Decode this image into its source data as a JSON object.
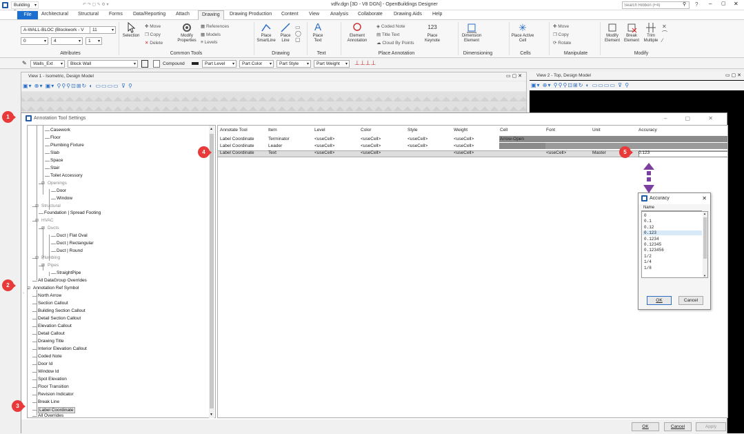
{
  "app": {
    "title": "vdfv.dgn [3D - V8 DGN] - OpenBuildings Designer",
    "workspace": "Building Design",
    "search_placeholder": "Search Ribbon (F4)"
  },
  "ribbon_tabs": [
    "File",
    "Architectural",
    "Structural",
    "Forms",
    "Data/Reporting",
    "Attach",
    "Drawing",
    "Drawing Production",
    "Content",
    "View",
    "Analysis",
    "Collaborate",
    "Drawing Aids",
    "Help"
  ],
  "ribbon": {
    "attributes": {
      "label": "Attributes",
      "level": "A-WALL-BLOC (Blockwork - V",
      "weight": "11",
      "color": "0",
      "style": "4",
      "extra": "1"
    },
    "common_tools": {
      "label": "Common Tools",
      "selection": "Selection",
      "move": "Move",
      "copy": "Copy",
      "delete": "Delete",
      "modify_props": "Modify Properties",
      "references": "References",
      "models": "Models",
      "levels": "Levels"
    },
    "drawing": {
      "label": "Drawing",
      "smartline": "Place SmartLine",
      "line": "Place Line"
    },
    "text": {
      "label": "Text",
      "place_text": "Place Text"
    },
    "place_annotation": {
      "label": "Place Annotation",
      "element": "Element Annotation",
      "coded_note": "Coded Note",
      "title_text": "Title Text",
      "cloud": "Cloud By Points",
      "keynote": "Place Keynote",
      "keynote_num": "123"
    },
    "dimensioning": {
      "label": "Dimensioning",
      "dim": "Dimension Element"
    },
    "cells": {
      "label": "Cells",
      "active": "Place Active Cell"
    },
    "manipulate": {
      "label": "Manipulate",
      "move": "Move",
      "copy": "Copy",
      "rotate": "Rotate"
    },
    "modify": {
      "label": "Modify",
      "modify": "Modify Element",
      "break": "Break Element",
      "trim": "Trim Multiple"
    }
  },
  "attrbar": {
    "walls": "Walls_Ext",
    "block": "Block Wall",
    "compound": "Compound",
    "part_level": "Part Level",
    "part_color": "Part Color",
    "part_style": "Part Style",
    "part_weight": "Part Weight"
  },
  "views": {
    "view1": "View 1 - Isometric, Design Model",
    "view2": "View 2 - Top, Design Model"
  },
  "dialog": {
    "title": "Annotation Tool Settings",
    "ok": "OK",
    "cancel": "Cancel",
    "apply": "Apply"
  },
  "tree": [
    {
      "t": "Casework"
    },
    {
      "t": "Floor"
    },
    {
      "t": "Plumbing Fixture"
    },
    {
      "t": "Slab"
    },
    {
      "t": "Space"
    },
    {
      "t": "Stair"
    },
    {
      "t": "Toilet Accessory"
    },
    {
      "t": "Openings"
    },
    {
      "t": "Door"
    },
    {
      "t": "Window"
    },
    {
      "t": "Structural"
    },
    {
      "t": "Foundation | Spread Footing"
    },
    {
      "t": "HVAC"
    },
    {
      "t": "Ducts"
    },
    {
      "t": "Duct | Flat Oval"
    },
    {
      "t": "Duct | Rectangular"
    },
    {
      "t": "Duct | Round"
    },
    {
      "t": "Plumbing"
    },
    {
      "t": "Pipes"
    },
    {
      "t": "StraightPipe"
    },
    {
      "t": "All DataGroup Overrides"
    },
    {
      "t": "Annotation Ref Symbol"
    },
    {
      "t": "North Arrow"
    },
    {
      "t": "Section Callout"
    },
    {
      "t": "Building Section Callout"
    },
    {
      "t": "Detail Section Callout"
    },
    {
      "t": "Elevation Callout"
    },
    {
      "t": "Detail Callout"
    },
    {
      "t": "Drawing Title"
    },
    {
      "t": "Interior Elevation Callout"
    },
    {
      "t": "Coded Note"
    },
    {
      "t": "Door Id"
    },
    {
      "t": "Window Id"
    },
    {
      "t": "Spot Elevation"
    },
    {
      "t": "Floor Transition"
    },
    {
      "t": "Revision Indicator"
    },
    {
      "t": "Break Line"
    },
    {
      "t": "Label Coordinate"
    },
    {
      "t": "All Overrides"
    }
  ],
  "table": {
    "headers": [
      "Annotate Tool",
      "Item",
      "Level",
      "Color",
      "Style",
      "Weight",
      "Cell",
      "Font",
      "Unit",
      "Accuracy"
    ],
    "rows": [
      [
        "Label Coordinate",
        "Terminator",
        "<useCell>",
        "<useCell>",
        "<useCell>",
        "<useCell>",
        "Arrow-Open",
        "",
        "",
        ""
      ],
      [
        "Label Coordinate",
        "Leader",
        "<useCell>",
        "<useCell>",
        "<useCell>",
        "<useCell>",
        "",
        "",
        "",
        ""
      ],
      [
        "Label Coordinate",
        "Text",
        "<useCell>",
        "<useCell>",
        "",
        "<useCell>",
        "",
        "<useCell>",
        "Master",
        "0.123"
      ]
    ]
  },
  "accuracy": {
    "title": "Accuracy",
    "header": "Name",
    "items": [
      "0",
      "0.1",
      "0.12",
      "0.123",
      "0.1234",
      "0.12345",
      "0.123456",
      "1/2",
      "1/4",
      "1/8"
    ],
    "selected": "0.123",
    "ok": "OK",
    "cancel": "Cancel"
  },
  "callouts": [
    "1",
    "2",
    "3",
    "4",
    "5"
  ],
  "colors": {
    "accent": "#1a6fd1",
    "callout": "#e83a3a",
    "arrow": "#7b3fa0"
  }
}
